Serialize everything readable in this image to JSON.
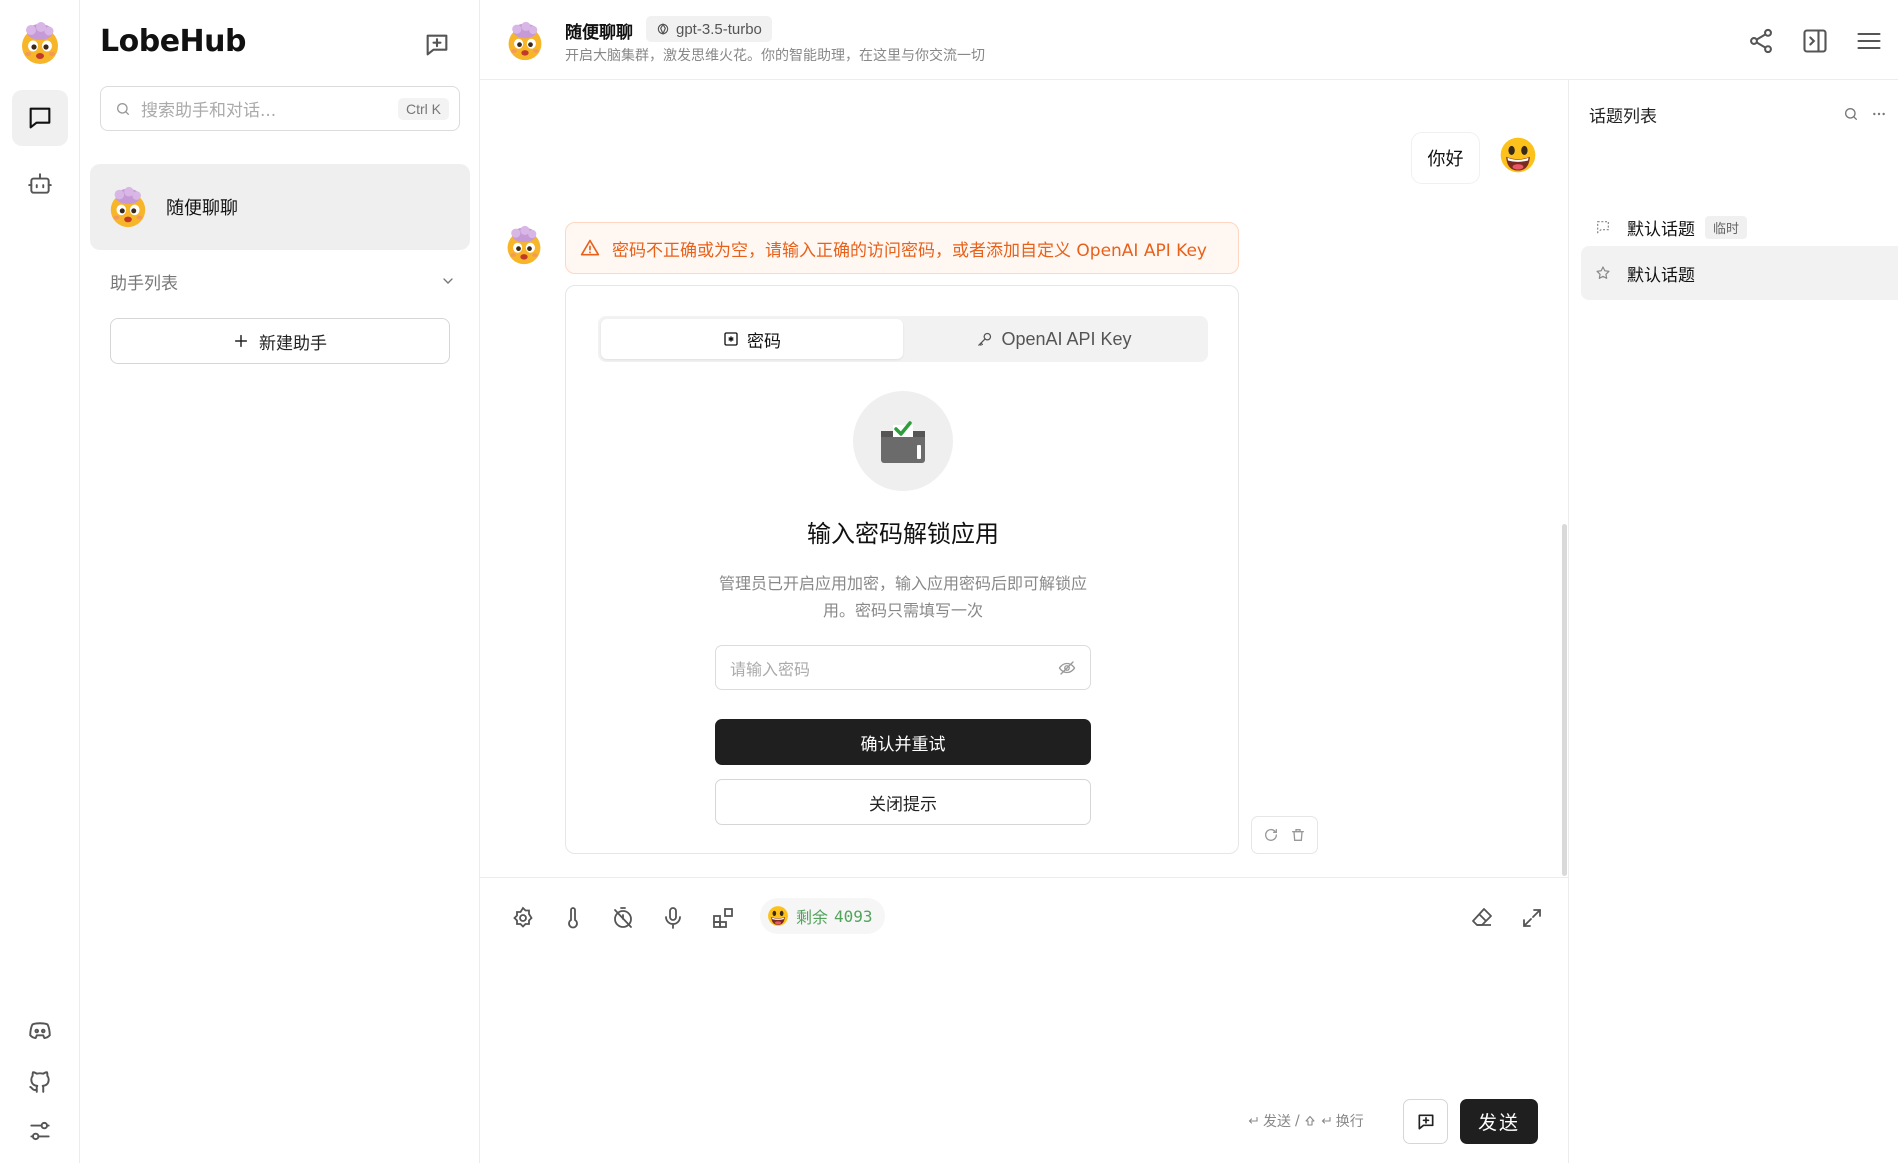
{
  "app": {
    "brand": "LobeHub"
  },
  "sidebar": {
    "search_placeholder": "搜索助手和对话...",
    "search_shortcut": "Ctrl K",
    "session_title": "随便聊聊",
    "group_label": "助手列表",
    "new_agent_label": "新建助手"
  },
  "header": {
    "title": "随便聊聊",
    "model": "gpt-3.5-turbo",
    "description": "开启大脑集群，激发思维火花。你的智能助理，在这里与你交流一切"
  },
  "chat": {
    "user_message": "你好",
    "error_alert": "密码不正确或为空，请输入正确的访问密码，或者添加自定义 OpenAI API Key",
    "tabs": [
      {
        "label": "密码",
        "icon": "password-icon",
        "active": true
      },
      {
        "label": "OpenAI API Key",
        "icon": "key-icon",
        "active": false
      }
    ],
    "unlock_title": "输入密码解锁应用",
    "unlock_desc": "管理员已开启应用加密，输入应用密码后即可解锁应用。密码只需填写一次",
    "password_placeholder": "请输入密码",
    "confirm_label": "确认并重试",
    "close_label": "关闭提示"
  },
  "input": {
    "token_label": "剩余",
    "token_count": "4093",
    "hint_send": "发送",
    "hint_sep": "/",
    "hint_newline": "换行",
    "send_label": "发送"
  },
  "topics": {
    "title": "话题列表",
    "items": [
      {
        "label": "默认话题",
        "tag": "临时",
        "icon": "chat-bubble-dashed-icon",
        "active": false
      },
      {
        "label": "默认话题",
        "tag": "",
        "icon": "star-icon",
        "active": true
      }
    ]
  },
  "colors": {
    "accent": "#1f1f1f",
    "alert_text": "#e8611a",
    "alert_bg": "#fff7f2",
    "token_green": "#52a35b"
  }
}
